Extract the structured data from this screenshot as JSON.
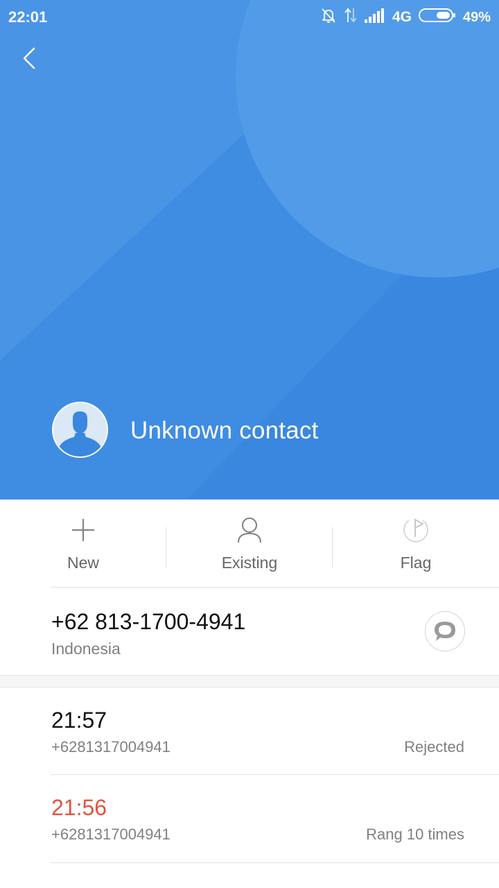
{
  "status_bar": {
    "time": "22:01",
    "network": "4G",
    "battery": "49%",
    "icons": [
      "bell-muted-icon",
      "data-arrows-icon",
      "signal-icon",
      "battery-icon"
    ]
  },
  "header": {
    "back_icon": "back-chevron-icon",
    "avatar_icon": "person-silhouette-icon",
    "contact_name": "Unknown contact",
    "colors": {
      "base": "#3a87e0",
      "light": "#4a94e6",
      "circle": "#529be9"
    }
  },
  "actions": [
    {
      "label": "New",
      "icon": "plus-icon"
    },
    {
      "label": "Existing",
      "icon": "person-outline-icon"
    },
    {
      "label": "Flag",
      "icon": "flag-icon"
    }
  ],
  "number": {
    "value": "+62 813-1700-4941",
    "region": "Indonesia",
    "message_icon": "message-bubble-icon"
  },
  "call_log": [
    {
      "time": "21:57",
      "number": "+6281317004941",
      "status": "Rejected",
      "missed": false
    },
    {
      "time": "21:56",
      "number": "+6281317004941",
      "status": "Rang 10 times",
      "missed": true
    }
  ],
  "colors": {
    "missed": "#e5533f",
    "secondary_text": "#808080"
  }
}
